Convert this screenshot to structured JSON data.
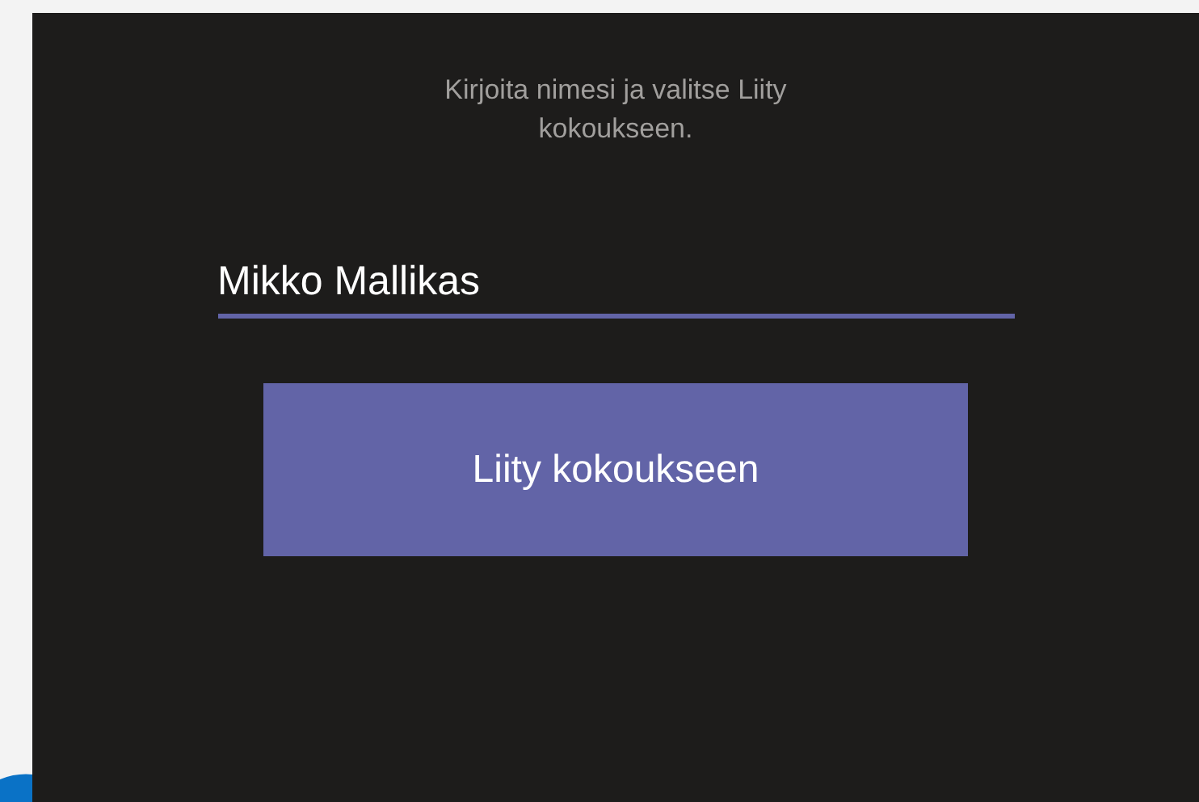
{
  "instruction": "Kirjoita nimesi ja valitse Liity kokoukseen.",
  "name_field": {
    "value": "Mikko Mallikas"
  },
  "join_button": {
    "label": "Liity kokoukseen"
  }
}
